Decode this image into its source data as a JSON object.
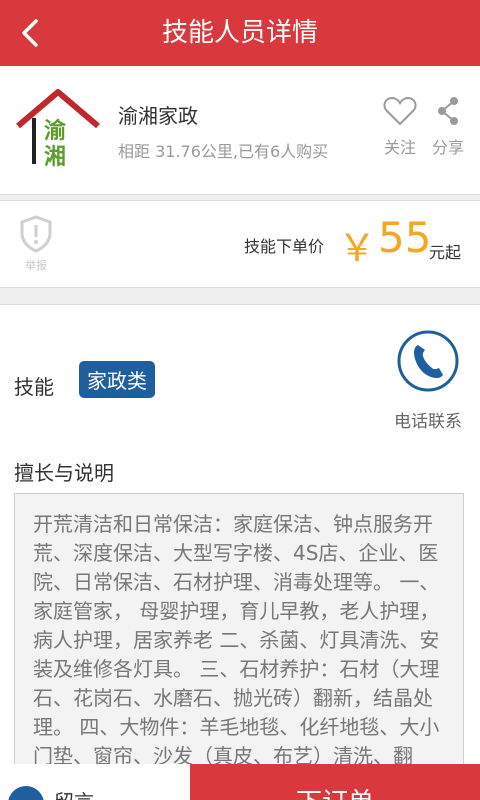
{
  "header": {
    "title": "技能人员详情",
    "back_icon": "chevron-left-icon"
  },
  "shop": {
    "name": "渝湘家政",
    "logo_text": "渝湘",
    "meta": "相距 31.76公里,已有6人购买",
    "follow_label": "关注",
    "share_label": "分享"
  },
  "price": {
    "report_label": "举报",
    "label": "技能下单价",
    "symbol": "￥",
    "value": "55",
    "unit": "元起"
  },
  "skill": {
    "label": "技能",
    "tag": "家政类",
    "phone_label": "电话联系"
  },
  "description": {
    "title": "擅长与说明",
    "text": "开荒清洁和日常保洁：家庭保洁、钟点服务开荒、深度保洁、大型写字楼、4S店、企业、医院、日常保洁、石材护理、消毒处理等。 一、家庭管家， 母婴护理，育儿早教，老人护理，病人护理，居家养老 二、杀菌、灯具清洗、安装及维修各灯具。 三、石材养护：石材（大理石、花岗石、水磨石、抛光砖）翻新，结晶处理。 四、大物件：羊毛地毯、化纤地毯、大小门垫、窗帘、沙发（真皮、布艺）清洗、翻新、杀菌消毒。"
  },
  "bottom": {
    "message_label": "留言",
    "order_label": "下订单"
  },
  "colors": {
    "brand_red": "#d9393c",
    "price_orange": "#f5a623",
    "tag_blue": "#1f5fa0"
  }
}
